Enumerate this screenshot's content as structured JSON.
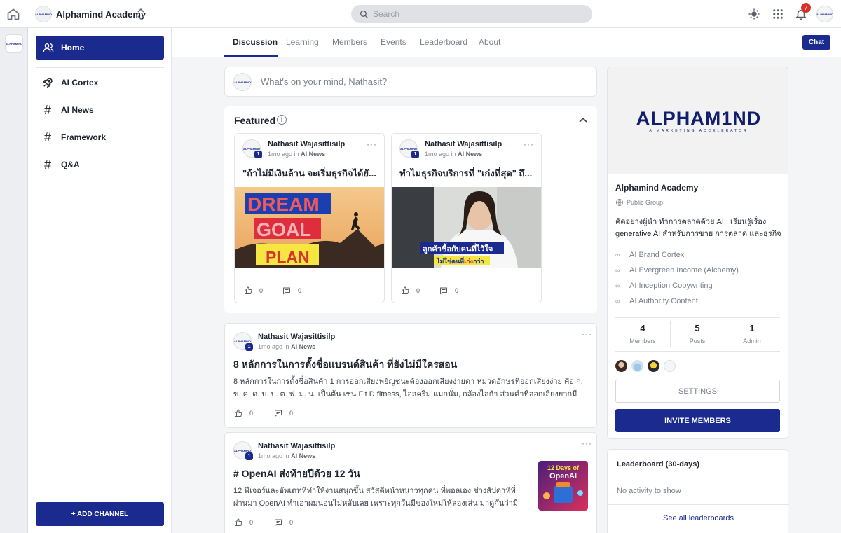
{
  "topbar": {
    "space_name": "Alphamind Academy",
    "search_placeholder": "Search",
    "notification_count": "7",
    "logo_text": "ALPHAMIND"
  },
  "sidebar": {
    "home_label": "Home",
    "items": [
      {
        "label": "AI Cortex",
        "icon": "rocket-icon"
      },
      {
        "label": "AI News",
        "icon": "hash-icon"
      },
      {
        "label": "Framework",
        "icon": "hash-icon"
      },
      {
        "label": "Q&A",
        "icon": "hash-icon"
      }
    ],
    "add_channel_label": "+ ADD CHANNEL"
  },
  "tabs": [
    "Discussion",
    "Learning",
    "Members",
    "Events",
    "Leaderboard",
    "About"
  ],
  "chat_label": "Chat",
  "composer": {
    "placeholder": "What's on your mind, Nathasit?"
  },
  "featured": {
    "title": "Featured",
    "posts": [
      {
        "author": "Nathasit Wajasittisilp",
        "time": "1mo ago",
        "in": "in",
        "channel": "AI News",
        "title": "\"ถ้าไม่มีเงินล้าน จะเริ่มธุรกิจได้ยั...",
        "image_words": [
          "DREAM",
          "GOAL",
          "PLAN"
        ],
        "likes": "0",
        "comments": "0"
      },
      {
        "author": "Nathasit Wajasittisilp",
        "time": "1mo ago",
        "in": "in",
        "channel": "AI News",
        "title": "ทำไมธุรกิจบริการที่ \"เก่งที่สุด\" ถึ...",
        "image_caption_1": "ลูกค้าซื้อกับคนที่ไว้ใจ",
        "image_caption_2a": "ไม่ใช่คนที่",
        "image_caption_2b": "เก่ง",
        "image_caption_2c": "กว่า",
        "likes": "0",
        "comments": "0"
      }
    ]
  },
  "posts": [
    {
      "author": "Nathasit Wajasittisilp",
      "time": "1mo ago",
      "in": "in",
      "channel": "AI News",
      "title": "8 หลักการในการตั้งชื่อแบรนด์สินค้า ที่ยังไม่มีใครสอน",
      "body": "8 หลักการในการตั้งชื่อสินค้า 1 การออกเสียงพยัญชนะต้องออกเสียงง่ายดา หมวดอักษรที่ออกเสียงง่าย คือ ก. ข. ค. ด. บ. ป. ต. ฟ. ม. น. เป็นต้น เช่น Fit D fitness, ไอสครีม แมกนั่ม, กล้องไลก้า ส่วนคำที่ออกเสียงยากมีตัวอย่...",
      "likes": "0",
      "comments": "0"
    },
    {
      "author": "Nathasit Wajasittisilp",
      "time": "1mo ago",
      "in": "in",
      "channel": "AI News",
      "title": "# OpenAI ส่งท้ายปีด้วย 12 วัน",
      "body": "12 ฟีเจอร์และอัพเดทที่ทำให้งานสนุกขึ้น สวัสดีหน้าหนาวทุกคน ที่พอลเอง ช่วงสัปดาห์ที่ผ่านมา OpenAI ทำเอาผมนอนไม่หลับเลย เพราะทุกวันมีของใหม่ให้ลองเล่น มาดูกันว่ามีอะไรน่าสนใจ...",
      "thumb_line1": "12 Days of",
      "thumb_line2": "OpenAI",
      "likes": "0",
      "comments": "0"
    }
  ],
  "about": {
    "logo_main": "ALPHAM1ND",
    "logo_sub": "A MARKETING ACCELERATOR",
    "name": "Alphamind Academy",
    "type": "Public Group",
    "description": "คิดอย่างผู้นำ ทำการตลาดด้วย AI : เรียนรู้เรื่อง generative AI สำหรับการขาย การตลาด และธุรกิจ",
    "links": [
      "AI Brand Cortex",
      "AI Evergreen Income (Alchemy)",
      "AI Inception Copywriting",
      "AI Authority Content"
    ],
    "stats": [
      {
        "num": "4",
        "label": "Members"
      },
      {
        "num": "5",
        "label": "Posts"
      },
      {
        "num": "1",
        "label": "Admin"
      }
    ],
    "settings_label": "SETTINGS",
    "invite_label": "INVITE MEMBERS"
  },
  "leaderboard": {
    "title": "Leaderboard (30-days)",
    "empty": "No activity to show",
    "link": "See all leaderboards"
  },
  "colors": {
    "accent": "#1b2a8f",
    "badge": "#d93025"
  }
}
